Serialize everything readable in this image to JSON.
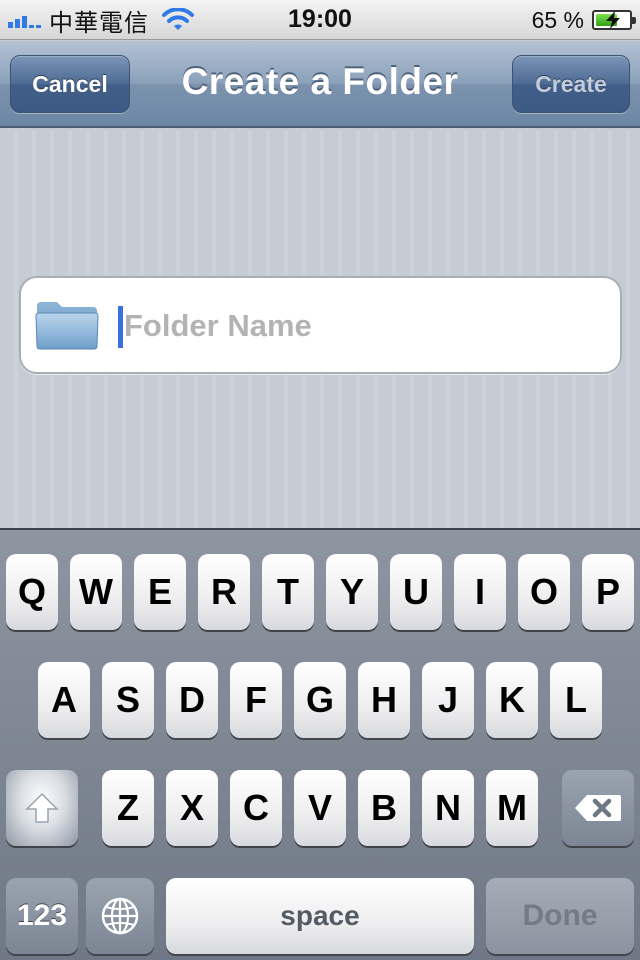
{
  "status_bar": {
    "carrier": "中華電信",
    "time": "19:00",
    "battery_percent": "65 %",
    "battery_level": 0.65,
    "icons": [
      "signal-icon",
      "wifi-icon",
      "battery-charging-icon"
    ]
  },
  "nav": {
    "title": "Create a Folder",
    "cancel_label": "Cancel",
    "create_label": "Create"
  },
  "folder_field": {
    "value": "",
    "placeholder": "Folder Name",
    "icon": "folder-icon"
  },
  "keyboard": {
    "row1": [
      "Q",
      "W",
      "E",
      "R",
      "T",
      "Y",
      "U",
      "I",
      "O",
      "P"
    ],
    "row2": [
      "A",
      "S",
      "D",
      "F",
      "G",
      "H",
      "J",
      "K",
      "L"
    ],
    "row3": [
      "Z",
      "X",
      "C",
      "V",
      "B",
      "N",
      "M"
    ],
    "num_label": "123",
    "space_label": "space",
    "done_label": "Done",
    "icons": [
      "shift-icon",
      "delete-icon",
      "globe-icon"
    ]
  },
  "colors": {
    "nav_accent": "#6d86a5",
    "caret": "#3c6fe0",
    "signal": "#2f7ae5",
    "battery_fill": "#2fa115"
  }
}
